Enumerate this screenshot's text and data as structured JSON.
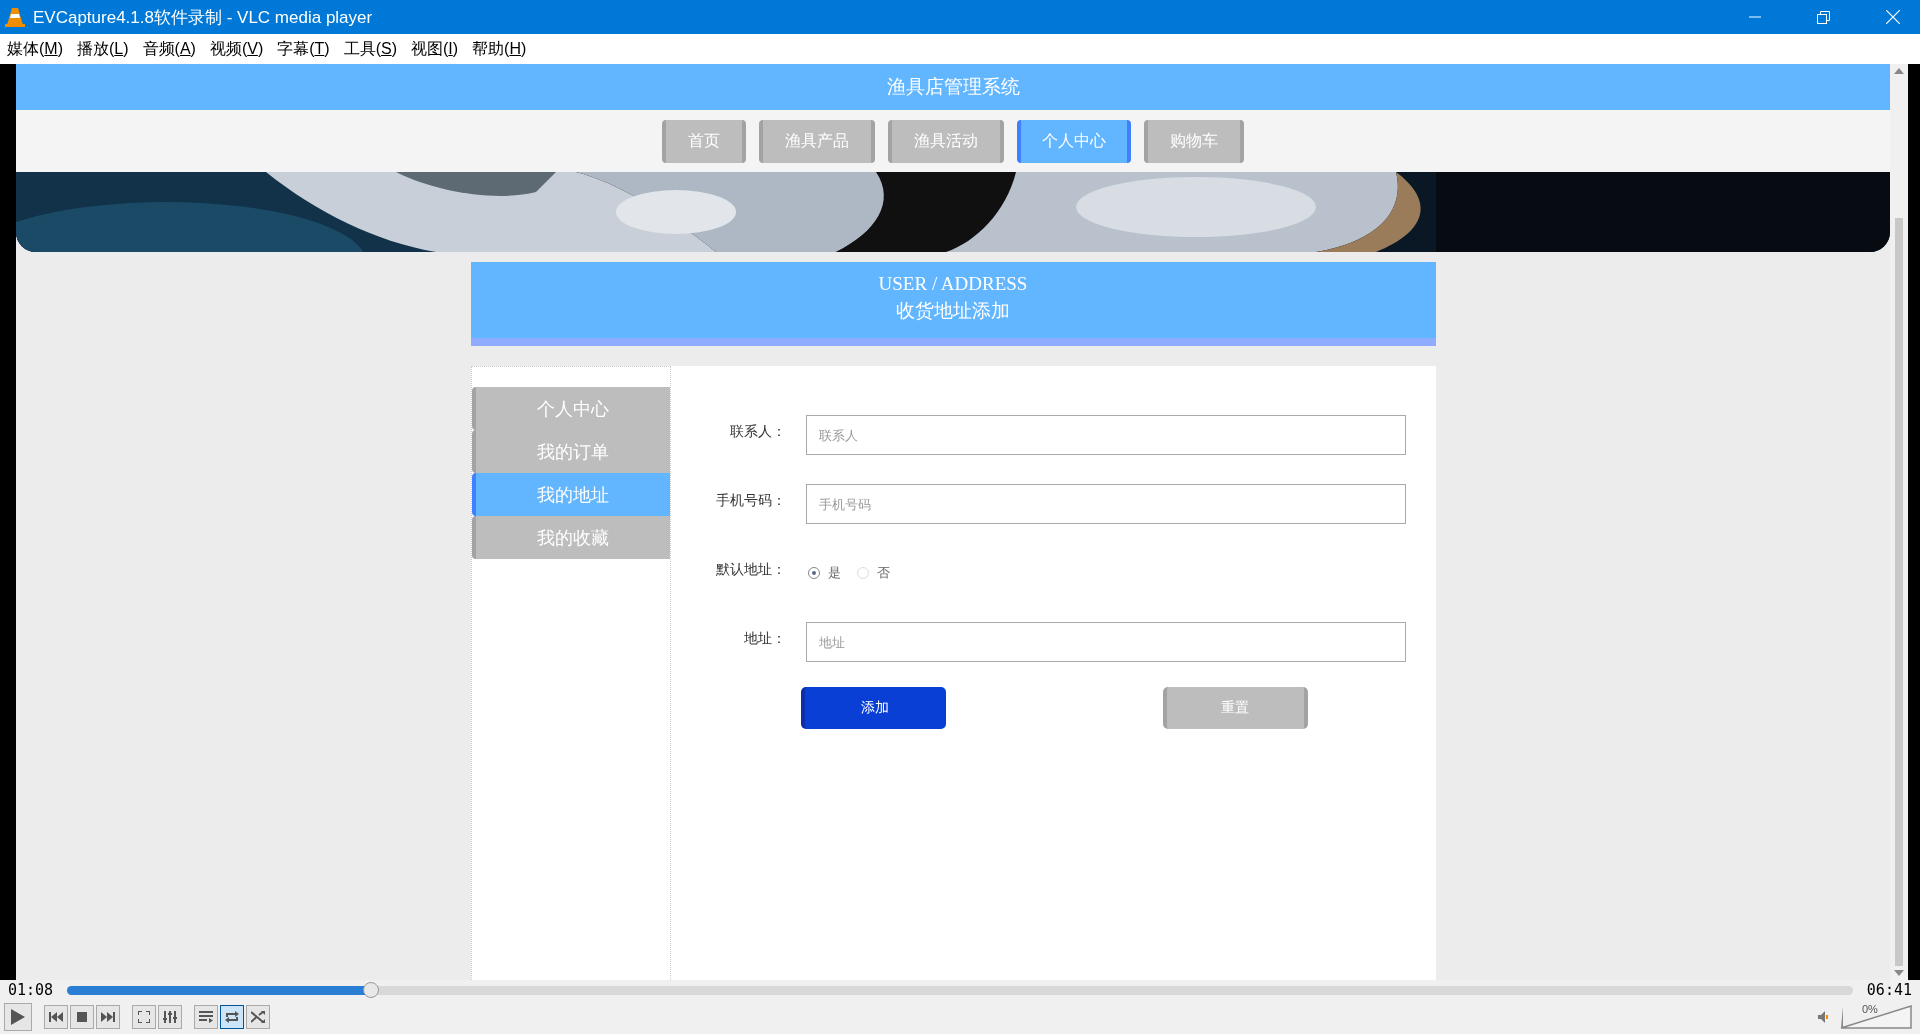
{
  "window": {
    "title": "EVCapture4.1.8软件录制 - VLC media player"
  },
  "menu": [
    {
      "before": "媒体(",
      "key": "M",
      "after": ")"
    },
    {
      "before": "播放(",
      "key": "L",
      "after": ")"
    },
    {
      "before": "音频(",
      "key": "A",
      "after": ")"
    },
    {
      "before": "视频(",
      "key": "V",
      "after": ")"
    },
    {
      "before": "字幕(",
      "key": "T",
      "after": ")"
    },
    {
      "before": "工具(",
      "key": "S",
      "after": ")"
    },
    {
      "before": "视图(",
      "key": "I",
      "after": ")"
    },
    {
      "before": "帮助(",
      "key": "H",
      "after": ")"
    }
  ],
  "page": {
    "site_title": "渔具店管理系统",
    "nav": [
      {
        "label": "首页",
        "selected": false
      },
      {
        "label": "渔具产品",
        "selected": false
      },
      {
        "label": "渔具活动",
        "selected": false
      },
      {
        "label": "个人中心",
        "selected": true
      },
      {
        "label": "购物车",
        "selected": false
      }
    ],
    "heading": {
      "english": "USER / ADDRESS",
      "chinese": "收货地址添加"
    },
    "sidebar": [
      {
        "label": "个人中心",
        "selected": false
      },
      {
        "label": "我的订单",
        "selected": false
      },
      {
        "label": "我的地址",
        "selected": true
      },
      {
        "label": "我的收藏",
        "selected": false
      }
    ],
    "form": [
      {
        "kind": "text",
        "label": "联系人：",
        "placeholder": "联系人"
      },
      {
        "kind": "text",
        "label": "手机号码：",
        "placeholder": "手机号码"
      },
      {
        "kind": "radio",
        "label": "默认地址：",
        "options": [
          {
            "label": "是",
            "selected": true
          },
          {
            "label": "否",
            "selected": false
          }
        ]
      },
      {
        "kind": "text",
        "label": "地址：",
        "placeholder": "地址"
      }
    ],
    "buttons": [
      {
        "label": "添加",
        "kind": "primary"
      },
      {
        "label": "重置",
        "kind": "secondary"
      }
    ]
  },
  "player": {
    "elapsed": "01:08",
    "total": "06:41",
    "seek": {
      "level": 0.17
    },
    "repeat_on": true,
    "volume": {
      "level": 0,
      "reading": "0%"
    }
  }
}
